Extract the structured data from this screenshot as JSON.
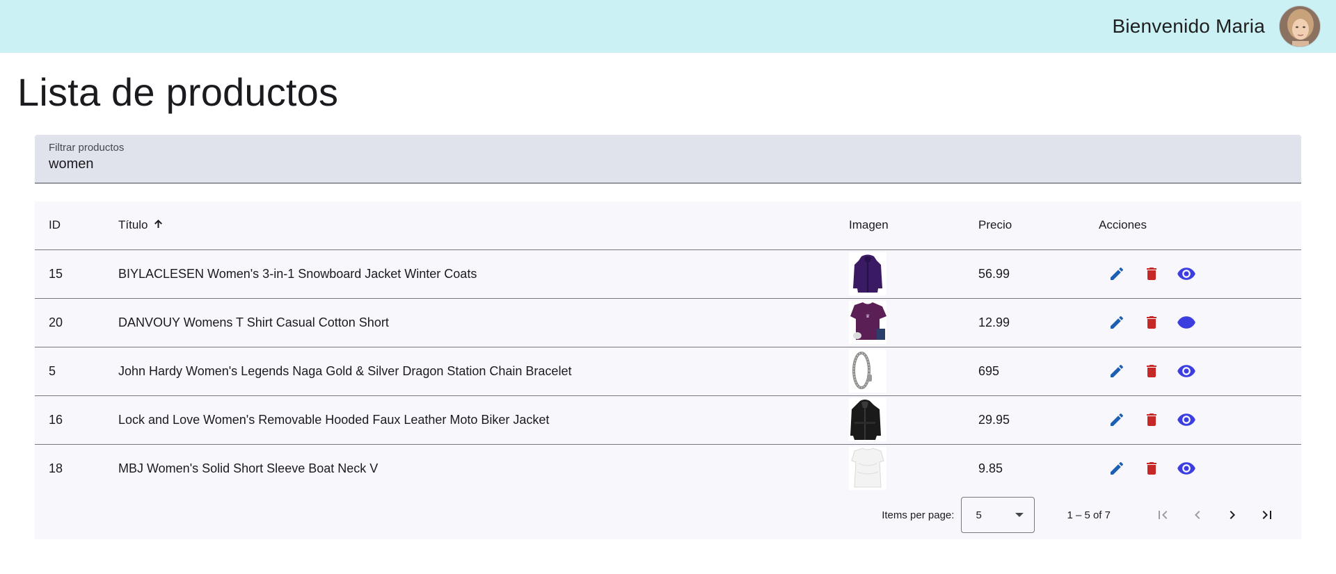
{
  "header": {
    "welcome": "Bienvenido Maria"
  },
  "page": {
    "title": "Lista de productos"
  },
  "filter": {
    "label": "Filtrar productos",
    "value": "women"
  },
  "table": {
    "columns": [
      "ID",
      "Título",
      "Imagen",
      "Precio",
      "Acciones"
    ],
    "sort_column": "Título",
    "sort_direction": "ascending",
    "rows": [
      {
        "id": "15",
        "title": "BIYLACLESEN Women's 3-in-1 Snowboard Jacket Winter Coats",
        "image": "purple-jacket",
        "price": "56.99"
      },
      {
        "id": "20",
        "title": "DANVOUY Womens T Shirt Casual Cotton Short",
        "image": "purple-tshirt",
        "price": "12.99"
      },
      {
        "id": "5",
        "title": "John Hardy Women's Legends Naga Gold & Silver Dragon Station Chain Bracelet",
        "image": "silver-bracelet",
        "price": "695"
      },
      {
        "id": "16",
        "title": "Lock and Love Women's Removable Hooded Faux Leather Moto Biker Jacket",
        "image": "black-leather-jacket",
        "price": "29.95"
      },
      {
        "id": "18",
        "title": "MBJ Women's Solid Short Sleeve Boat Neck V",
        "image": "white-top",
        "price": "9.85"
      }
    ]
  },
  "paginator": {
    "items_per_page_label": "Items per page:",
    "page_size": "5",
    "range": "1 – 5 of 7"
  },
  "colors": {
    "topbar": "#cbf1f4",
    "edit": "#1d5fb0",
    "delete": "#c62828",
    "view": "#3d3ee0"
  }
}
